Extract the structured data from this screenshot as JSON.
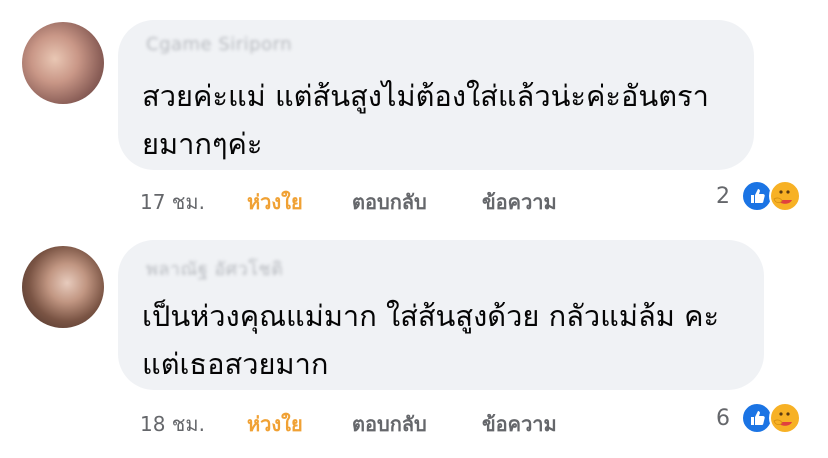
{
  "comments": [
    {
      "author": "Cgame Siriporn",
      "text_line1": "สวยค่ะแม่ แต่ส้นสูงไม่ต้องใส่แล้วน่ะค่ะอันตรา",
      "text_line2": "ยมากๆค่ะ",
      "time": "17 ชม.",
      "love_label": "ห่วงใย",
      "reply_label": "ตอบกลับ",
      "message_label": "ข้อความ",
      "reaction_count": "2"
    },
    {
      "author": "พลาณัฐ อัศวโชติ",
      "text_line1": "เป็นห่วงคุณแม่มาก ใส่ส้นสูงด้วย กลัวแม่ล้ม คะ",
      "text_line2": "แต่เธอสวยมาก",
      "time": "18 ชม.",
      "love_label": "ห่วงใย",
      "reply_label": "ตอบกลับ",
      "message_label": "ข้อความ",
      "reaction_count": "6"
    }
  ],
  "reaction_icons": [
    "like-icon",
    "care-icon"
  ],
  "colors": {
    "bubble": "#f0f2f5",
    "love_active": "#f0a134",
    "muted_text": "#65676b",
    "like_blue": "#1b74e4",
    "care_yellow": "#f7b125"
  }
}
